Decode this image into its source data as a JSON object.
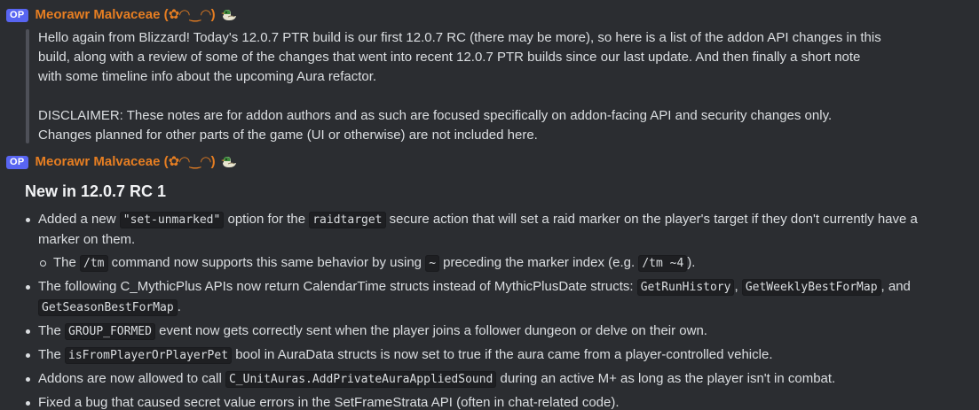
{
  "messages": [
    {
      "badge": "OP",
      "author": "Meorawr Malvaceae (✿◠‿◠)",
      "quote": {
        "p1": "Hello again from Blizzard! Today's 12.0.7 PTR build is our first 12.0.7 RC (there may be more), so here is a list of the addon API changes in this build, along with a review of some of the changes that went into recent 12.0.7 PTR builds since our last update. And then finally a short note with some timeline info about the upcoming Aura refactor.",
        "p2": "DISCLAIMER: These notes are for addon authors and as such are focused specifically on addon-facing API and security changes only. Changes planned for other parts of the game (UI or otherwise) are not included here."
      }
    },
    {
      "badge": "OP",
      "author": "Meorawr Malvaceae (✿◠‿◠)",
      "heading": "New in 12.0.7 RC 1",
      "bullets": {
        "b1": {
          "pre": "Added a new ",
          "code1": "\"set-unmarked\"",
          "mid": " option for the ",
          "code2": "raidtarget",
          "post": " secure action that will set a raid marker on the player's target if they don't currently have a marker on them."
        },
        "b1sub": {
          "pre": "The ",
          "code1": "/tm",
          "mid": " command now supports this same behavior by using ",
          "code2": "~",
          "mid2": " preceding the marker index (e.g. ",
          "code3": "/tm ~4",
          "post": ")."
        },
        "b2": {
          "pre": "The following C_MythicPlus APIs now return CalendarTime structs instead of MythicPlusDate structs: ",
          "code1": "GetRunHistory",
          "sep1": ", ",
          "code2": "GetWeeklyBestForMap",
          "sep2": ", and ",
          "code3": "GetSeasonBestForMap",
          "post": "."
        },
        "b3": {
          "pre": "The ",
          "code1": "GROUP_FORMED",
          "post": " event now gets correctly sent when the player joins a follower dungeon or delve on their own."
        },
        "b4": {
          "pre": "The ",
          "code1": "isFromPlayerOrPlayerPet",
          "post": " bool in AuraData structs is now set to true if the aura came from a player-controlled vehicle."
        },
        "b5": {
          "pre": "Addons are now allowed to call ",
          "code1": "C_UnitAuras.AddPrivateAuraAppliedSound",
          "post": " during an active M+ as long as the player isn't in combat."
        },
        "b6": {
          "text": "Fixed a bug that caused secret value errors in the SetFrameStrata API (often in chat-related code)."
        }
      }
    }
  ],
  "icons": {
    "author_emoji": "duck-icon"
  },
  "colors": {
    "background": "#2b2d31",
    "author": "#e67e22",
    "op_badge": "#5865f2",
    "quote_bar": "#4e5058",
    "code_bg": "#1e1f22"
  }
}
